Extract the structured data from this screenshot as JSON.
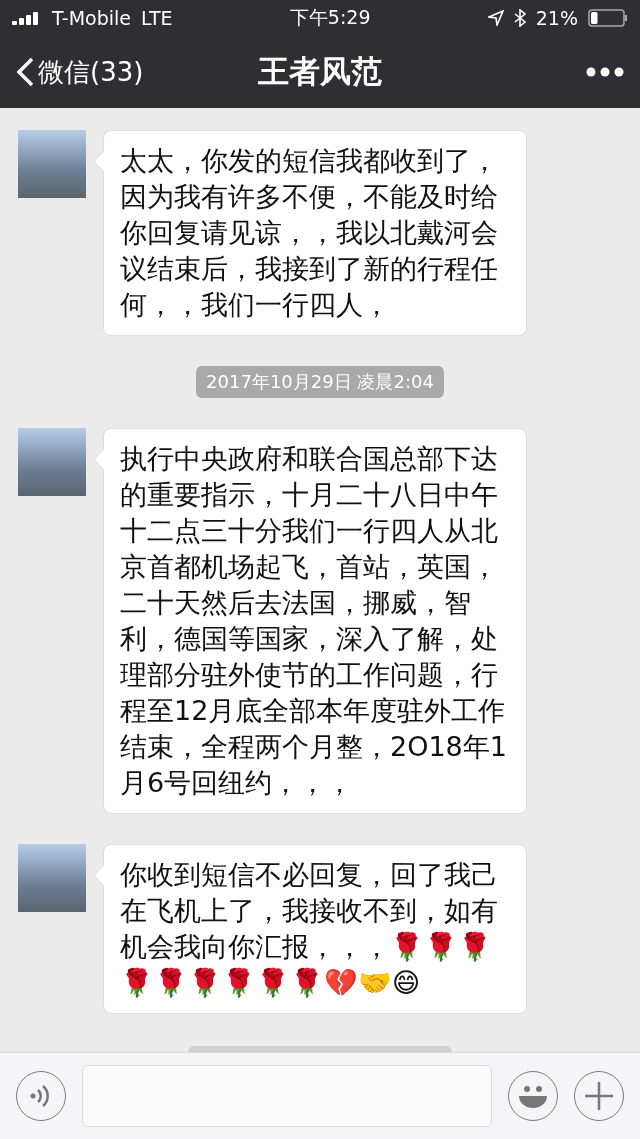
{
  "status_bar": {
    "carrier": "T-Mobile",
    "network": "LTE",
    "time": "下午5:29",
    "battery": "21%",
    "battery_icon": {
      "level": 0.21
    }
  },
  "nav": {
    "back": "微信(33)",
    "title": "王者风范"
  },
  "messages": [
    {
      "kind": "bubble",
      "text": "太太，你发的短信我都收到了，因为我有许多不便，不能及时给你回复请见谅，，我以北戴河会议结束后，我接到了新的行程任何，，我们一行四人，"
    },
    {
      "kind": "time",
      "text": "2017年10月29日 凌晨2:04"
    },
    {
      "kind": "bubble",
      "text": "执行中央政府和联合国总部下达的重要指示，十月二十八日中午十二点三十分我们一行四人从北京首都机场起飞，首站，英国，二十天然后去法国，挪威，智利，德国等国家，深入了解，处理部分驻外使节的工作问题，行程至12月底全部本年度驻外工作结束，全程两个月整，2O18年1月6号回纽约，，，"
    },
    {
      "kind": "bubble",
      "text": "你收到短信不必回复，回了我己在飞机上了，我接收不到，如有机会我向你汇报，，，🌹🌹🌹🌹🌹🌹🌹🌹🌹💔🤝😄"
    }
  ]
}
